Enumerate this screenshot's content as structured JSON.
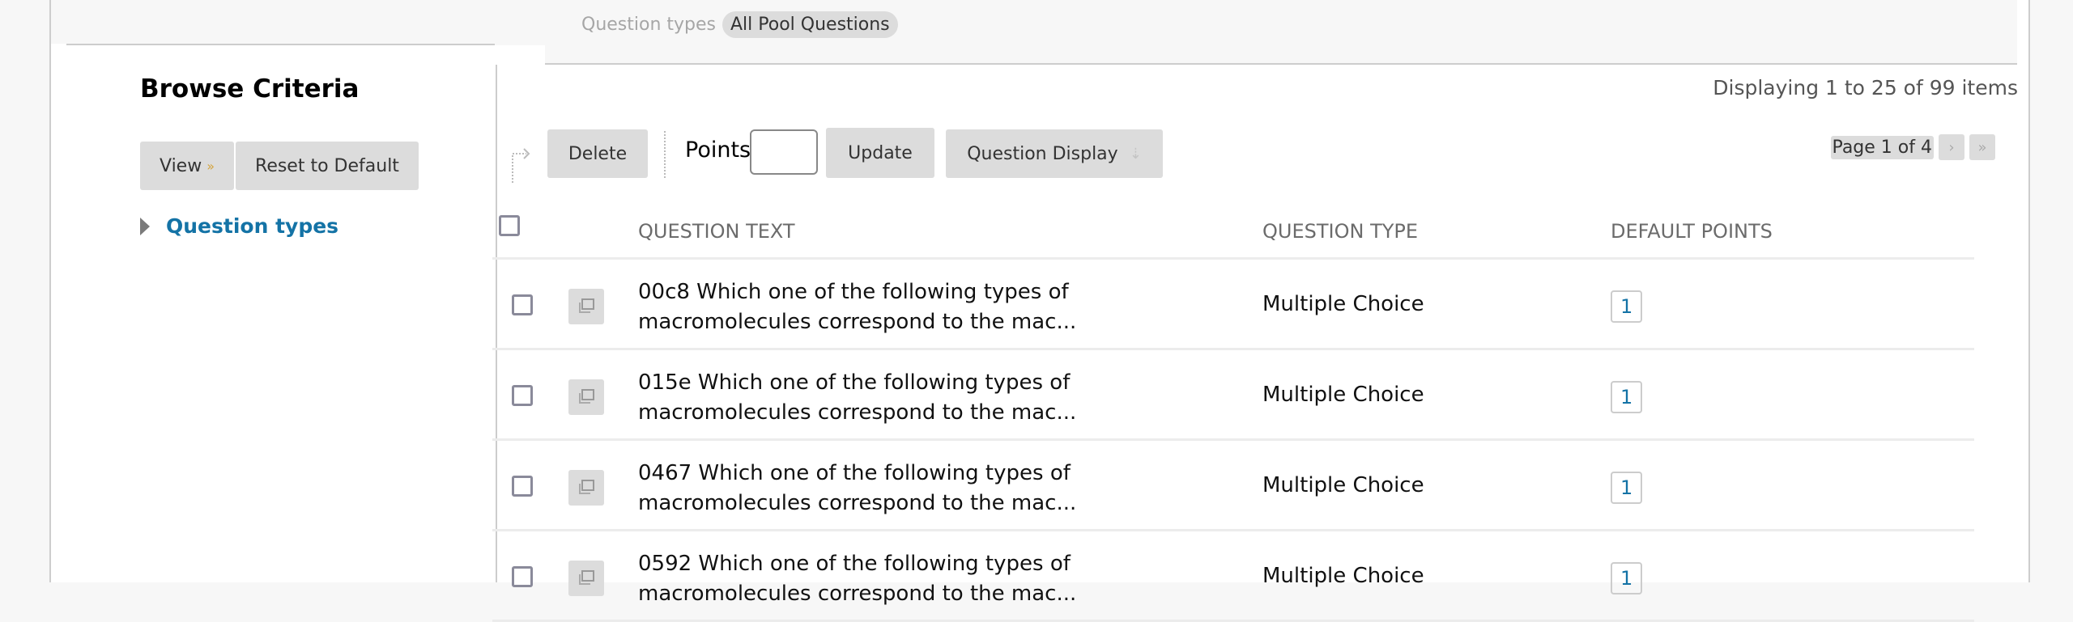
{
  "filter": {
    "label": "Question types",
    "value": "All Pool Questions"
  },
  "sidebar": {
    "title": "Browse Criteria",
    "view_label": "View",
    "view_icon": "double-chevron-down-icon",
    "reset_label": "Reset to Default",
    "tree": [
      {
        "label": "Question types",
        "expanded": false
      }
    ]
  },
  "main": {
    "display_count": "Displaying 1 to 25 of 99 items",
    "toolbar": {
      "delete_label": "Delete",
      "points_label": "Points",
      "points_value": "",
      "update_label": "Update",
      "question_display_label": "Question Display"
    },
    "pager": {
      "text": "Page 1 of 4",
      "next_icon": "chevron-right-icon",
      "last_icon": "double-chevron-right-icon"
    },
    "table": {
      "columns": [
        "QUESTION TEXT",
        "QUESTION TYPE",
        "DEFAULT POINTS"
      ],
      "rows": [
        {
          "text": "00c8 Which one of the following types of macromolecules correspond to the mac...",
          "type": "Multiple Choice",
          "points": "1"
        },
        {
          "text": "015e Which one of the following types of macromolecules correspond to the mac...",
          "type": "Multiple Choice",
          "points": "1"
        },
        {
          "text": "0467 Which one of the following types of macromolecules correspond to the mac...",
          "type": "Multiple Choice",
          "points": "1"
        },
        {
          "text": "0592 Which one of the following types of macromolecules correspond to the mac...",
          "type": "Multiple Choice",
          "points": "1"
        }
      ]
    }
  },
  "colors": {
    "link": "#1473a6",
    "button_bg": "#dcdcdc",
    "view_chevron": "#d4a33b"
  }
}
